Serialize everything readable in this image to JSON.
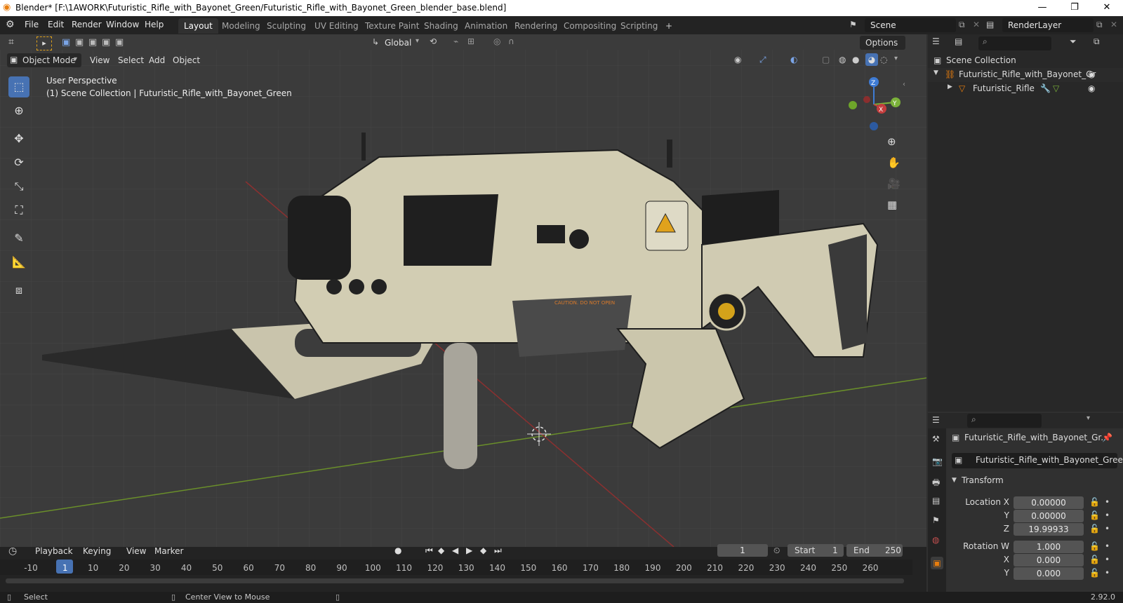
{
  "window": {
    "title": "Blender* [F:\\1AWORK\\Futuristic_Rifle_with_Bayonet_Green/Futuristic_Rifle_with_Bayonet_Green_blender_base.blend]",
    "minimize": "—",
    "maximize": "❐",
    "close": "✕"
  },
  "menu": [
    "File",
    "Edit",
    "Render",
    "Window",
    "Help"
  ],
  "workspaces": [
    "Layout",
    "Modeling",
    "Sculpting",
    "UV Editing",
    "Texture Paint",
    "Shading",
    "Animation",
    "Rendering",
    "Compositing",
    "Scripting"
  ],
  "add_workspace": "+",
  "scene": {
    "label": "Scene",
    "render_layer": "RenderLayer"
  },
  "viewport_header": {
    "mode": "Object Mode",
    "menus": [
      "View",
      "Select",
      "Add",
      "Object"
    ],
    "orientation": "Global",
    "options": "Options"
  },
  "viewport": {
    "perspective": "User Perspective",
    "collection_info": "(1) Scene Collection | Futuristic_Rifle_with_Bayonet_Green",
    "gizmo_axes": [
      "Z",
      "X",
      "Y"
    ],
    "warning_text": "CAUTION. DO NOT OPEN"
  },
  "outliner": {
    "root": "Scene Collection",
    "items": [
      {
        "label": "Futuristic_Rifle_with_Bayonet_Gr",
        "depth": 1
      },
      {
        "label": "Futuristic_Rifle",
        "depth": 2
      }
    ]
  },
  "properties": {
    "object_name": "Futuristic_Rifle_with_Bayonet_Gr...",
    "object_field": "Futuristic_Rifle_with_Bayonet_Green",
    "panel": "Transform",
    "fields": [
      {
        "label": "Location X",
        "value": "0.00000"
      },
      {
        "label": "Y",
        "value": "0.00000"
      },
      {
        "label": "Z",
        "value": "19.99933"
      },
      {
        "label": "Rotation W",
        "value": "1.000"
      },
      {
        "label": "X",
        "value": "0.000"
      },
      {
        "label": "Y",
        "value": "0.000"
      }
    ]
  },
  "timeline": {
    "menus": [
      "Playback",
      "Keying",
      "View",
      "Marker"
    ],
    "current_frame": "1",
    "start_label": "Start",
    "start": "1",
    "end_label": "End",
    "end": "250",
    "ticks": [
      "-10",
      "1",
      "10",
      "20",
      "30",
      "40",
      "50",
      "60",
      "70",
      "80",
      "90",
      "100",
      "110",
      "120",
      "130",
      "140",
      "150",
      "160",
      "170",
      "180",
      "190",
      "200",
      "210",
      "220",
      "230",
      "240",
      "250",
      "260"
    ]
  },
  "status": {
    "left": "Select",
    "middle": "Center View to Mouse",
    "version": "2.92.0"
  }
}
